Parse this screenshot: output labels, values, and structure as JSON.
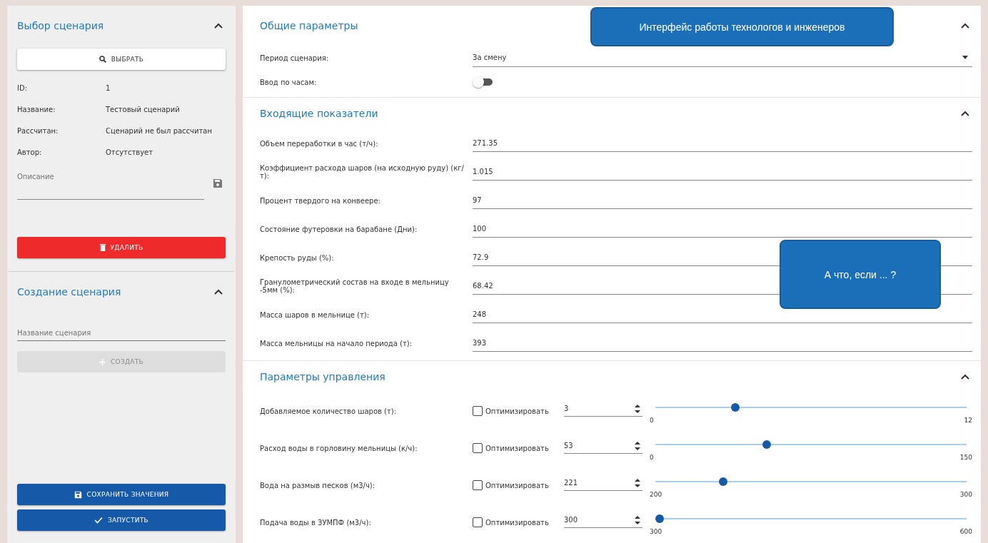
{
  "sidebar": {
    "select_section": {
      "title": "Выбор сценария",
      "expanded": true,
      "select_button": "ВЫБРАТЬ",
      "info": [
        {
          "label": "ID:",
          "value": "1"
        },
        {
          "label": "Название:",
          "value": "Тестовый сценарий"
        },
        {
          "label": "Рассчитан:",
          "value": "Сценарий не был рассчитан"
        },
        {
          "label": "Автор:",
          "value": "Отсутствует"
        }
      ],
      "description": {
        "placeholder": "Описание"
      },
      "delete_button": "УДАЛИТЬ"
    },
    "create_section": {
      "title": "Создание сценария",
      "expanded": true,
      "name_field": {
        "placeholder": "Название сценария"
      },
      "create_button": {
        "label": "СОЗДАТЬ",
        "disabled": true
      }
    },
    "save_button": "СОХРАНИТЬ ЗНАЧЕНИЯ",
    "run_button": "ЗАПУСТИТЬ"
  },
  "general": {
    "title": "Общие параметры",
    "expanded": true,
    "period": {
      "label": "Период сценария:",
      "value": "За смену"
    },
    "hourly": {
      "label": "Ввод по часам:",
      "on": false
    }
  },
  "inputs": {
    "title": "Входящие показатели",
    "expanded": true,
    "rows": [
      {
        "label": "Объем переработки в час (т/ч):",
        "value": "271.35"
      },
      {
        "label": "Коэффициент расхода шаров (на исходную руду) (кг/т):",
        "value": "1.015"
      },
      {
        "label": "Процент твердого на конвеере:",
        "value": "97"
      },
      {
        "label": "Состояние футеровки на барабане (Дни):",
        "value": "100"
      },
      {
        "label": "Крепость руды (%):",
        "value": "72.9"
      },
      {
        "label": "Гранулометрический состав на входе в мельницу -5мм (%):",
        "value": "68.42"
      },
      {
        "label": "Масса шаров в мельнице (т):",
        "value": "248"
      },
      {
        "label": "Масса мельницы на начало периода (т):",
        "value": "393"
      }
    ]
  },
  "controls": {
    "title": "Параметры управления",
    "expanded": true,
    "rows": [
      {
        "label": "Добавляемое количество шаров (т):",
        "optimize_label": "Оптимизировать",
        "optimize": false,
        "value": "3",
        "level": 0.25,
        "min": "0",
        "max": "12"
      },
      {
        "label": "Расход воды в горловину мельницы (к/ч):",
        "optimize_label": "Оптимизировать",
        "optimize": false,
        "value": "53",
        "level": 0.353,
        "min": "0",
        "max": "150"
      },
      {
        "label": "Вода на размыв песков (м3/ч):",
        "optimize_label": "Оптимизировать",
        "optimize": false,
        "value": "221",
        "level": 0.21,
        "min": "200",
        "max": "300"
      },
      {
        "label": "Подача воды в ЗУМПФ (м3/ч):",
        "optimize_label": "Оптимизировать",
        "optimize": false,
        "value": "300",
        "level": 0,
        "min": "300",
        "max": "600"
      }
    ]
  },
  "callouts": [
    {
      "text": "Интерфейс работы технологов и инженеров"
    },
    {
      "text": "А что, если ... ?"
    }
  ]
}
